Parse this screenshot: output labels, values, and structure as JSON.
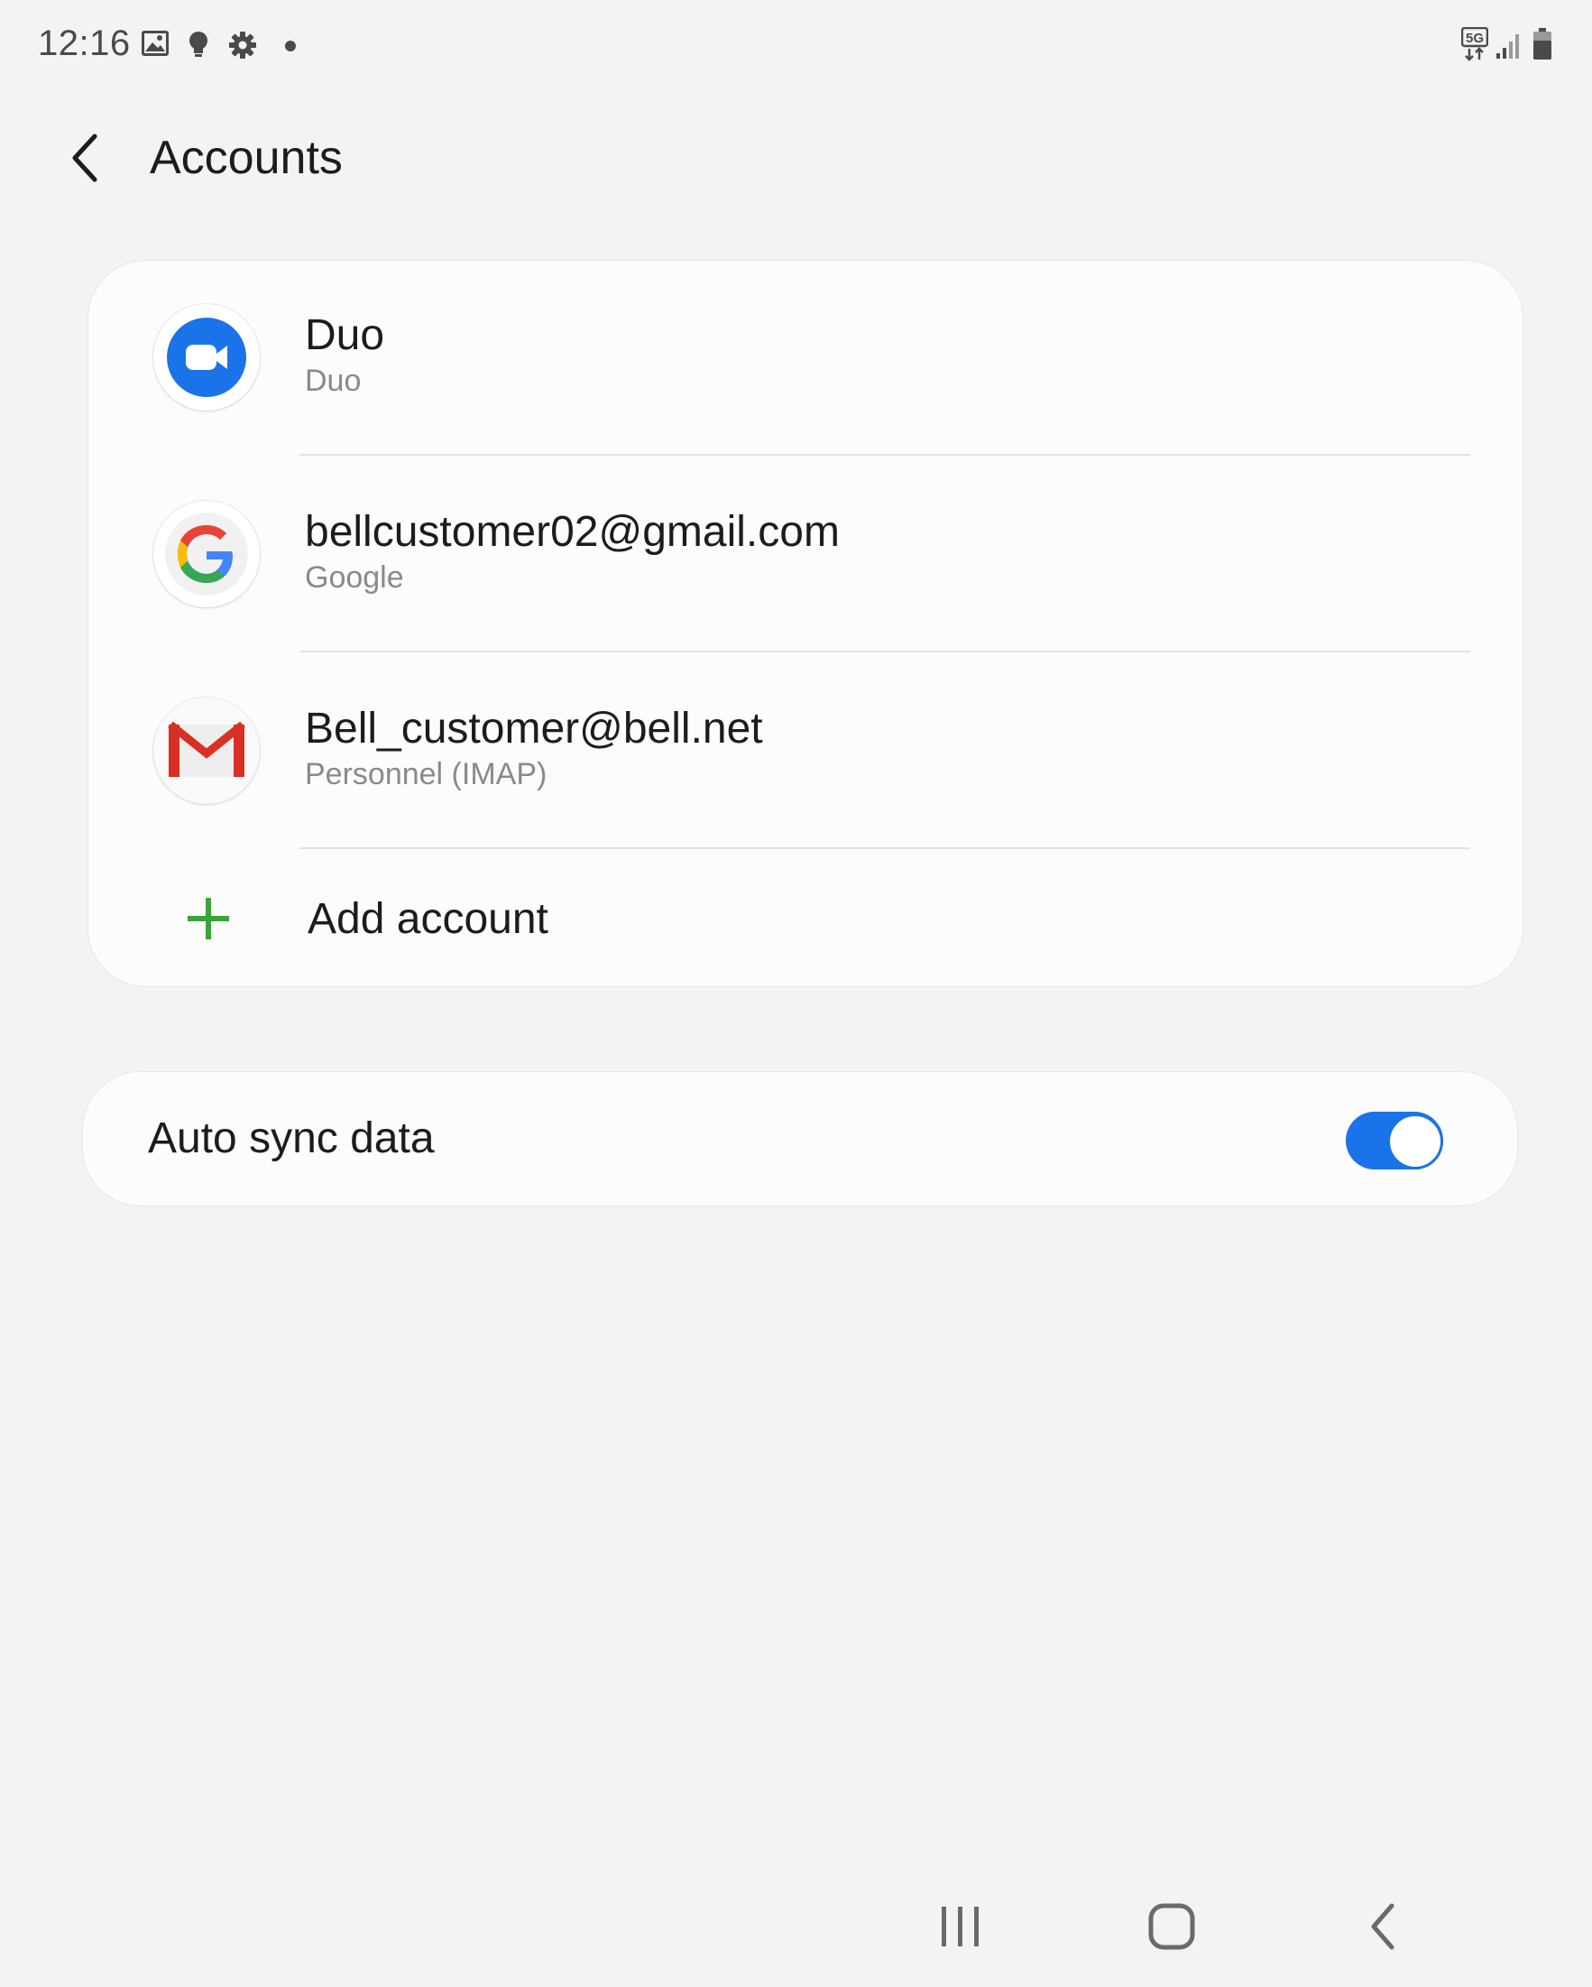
{
  "status_bar": {
    "time": "12:16",
    "left_icons": [
      "image-icon",
      "bulb-icon",
      "gear-icon",
      "dot-icon"
    ],
    "network_label": "5G",
    "right_icons": [
      "network-5g-icon",
      "signal-icon",
      "battery-icon"
    ]
  },
  "header": {
    "title": "Accounts",
    "back_icon": "chevron-left-icon"
  },
  "accounts": [
    {
      "title": "Duo",
      "subtitle": "Duo",
      "icon": "duo-icon"
    },
    {
      "title": "bellcustomer02@gmail.com",
      "subtitle": "Google",
      "icon": "google-icon"
    },
    {
      "title": "Bell_customer@bell.net",
      "subtitle": "Personnel (IMAP)",
      "icon": "gmail-icon"
    }
  ],
  "add_account": {
    "label": "Add account",
    "icon": "plus-icon",
    "color": "#3aa33a"
  },
  "sync": {
    "label": "Auto sync data",
    "enabled": true,
    "accent_color": "#1a73e8"
  },
  "nav_bar": {
    "icons": [
      "recent-apps-icon",
      "home-icon",
      "back-icon"
    ]
  }
}
